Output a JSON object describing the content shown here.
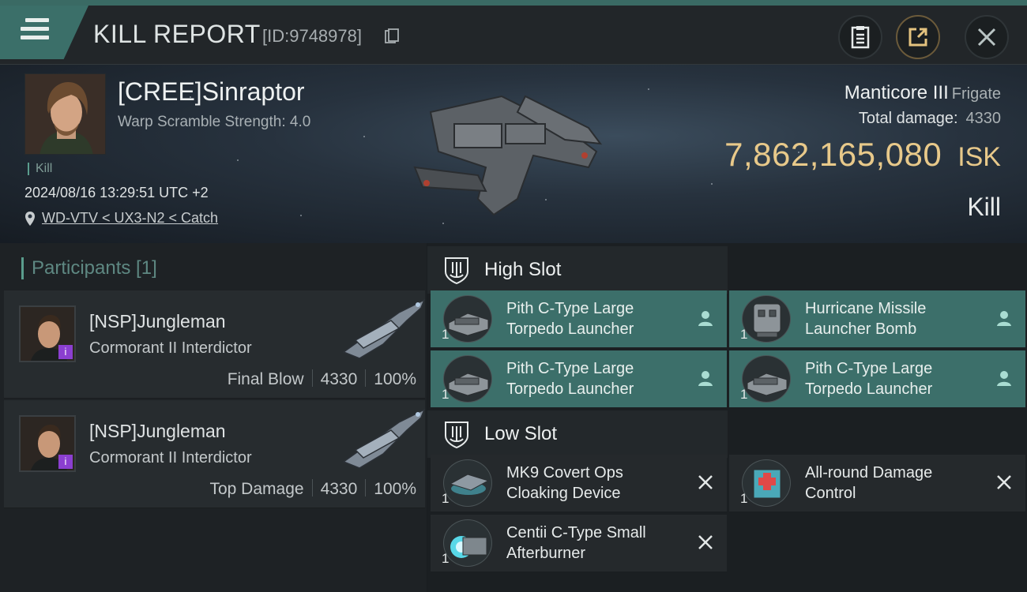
{
  "header": {
    "title": "KILL REPORT",
    "report_id": "[ID:9748978]"
  },
  "victim": {
    "name": "[CREE]Sinraptor",
    "warp_scramble": "Warp Scramble Strength: 4.0",
    "kill_tag": "Kill",
    "datetime": "2024/08/16 13:29:51 UTC +2",
    "location": "WD-VTV < UX3-N2 < Catch",
    "ship_name": "Manticore III",
    "ship_class": "Frigate",
    "total_damage_label": "Total damage:",
    "total_damage": "4330",
    "isk_value": "7,862,165,080",
    "isk_currency": "ISK",
    "result": "Kill"
  },
  "participants": {
    "title": "Participants [1]",
    "items": [
      {
        "name": "[NSP]Jungleman",
        "ship": "Cormorant II Interdictor",
        "role": "Final Blow",
        "damage": "4330",
        "percent": "100%",
        "badge": "i"
      },
      {
        "name": "[NSP]Jungleman",
        "ship": "Cormorant II Interdictor",
        "role": "Top Damage",
        "damage": "4330",
        "percent": "100%",
        "badge": "i"
      }
    ]
  },
  "fitting": {
    "high_slot": {
      "label": "High Slot",
      "modules": [
        {
          "line1": "Pith C-Type Large",
          "line2": "Torpedo Launcher",
          "qty": "1",
          "action_icon": "pilot-icon"
        },
        {
          "line1": "Hurricane Missile",
          "line2": "Launcher Bomb",
          "qty": "1",
          "action_icon": "pilot-icon"
        },
        {
          "line1": "Pith C-Type Large",
          "line2": "Torpedo Launcher",
          "qty": "1",
          "action_icon": "pilot-icon"
        },
        {
          "line1": "Pith C-Type Large",
          "line2": "Torpedo Launcher",
          "qty": "1",
          "action_icon": "pilot-icon"
        }
      ]
    },
    "low_slot": {
      "label": "Low Slot",
      "modules": [
        {
          "line1": "MK9 Covert Ops",
          "line2": "Cloaking Device",
          "qty": "1",
          "action_icon": "destroyed-x-icon"
        },
        {
          "line1": "All-round Damage",
          "line2": "Control",
          "qty": "1",
          "action_icon": "destroyed-x-icon"
        },
        {
          "line1": "Centii C-Type Small",
          "line2": "Afterburner",
          "qty": "1",
          "action_icon": "destroyed-x-icon"
        }
      ]
    }
  },
  "colors": {
    "accent_teal": "#3c6f6a",
    "isk_gold": "#e8c98a",
    "badge_purple": "#8b3fd0"
  }
}
